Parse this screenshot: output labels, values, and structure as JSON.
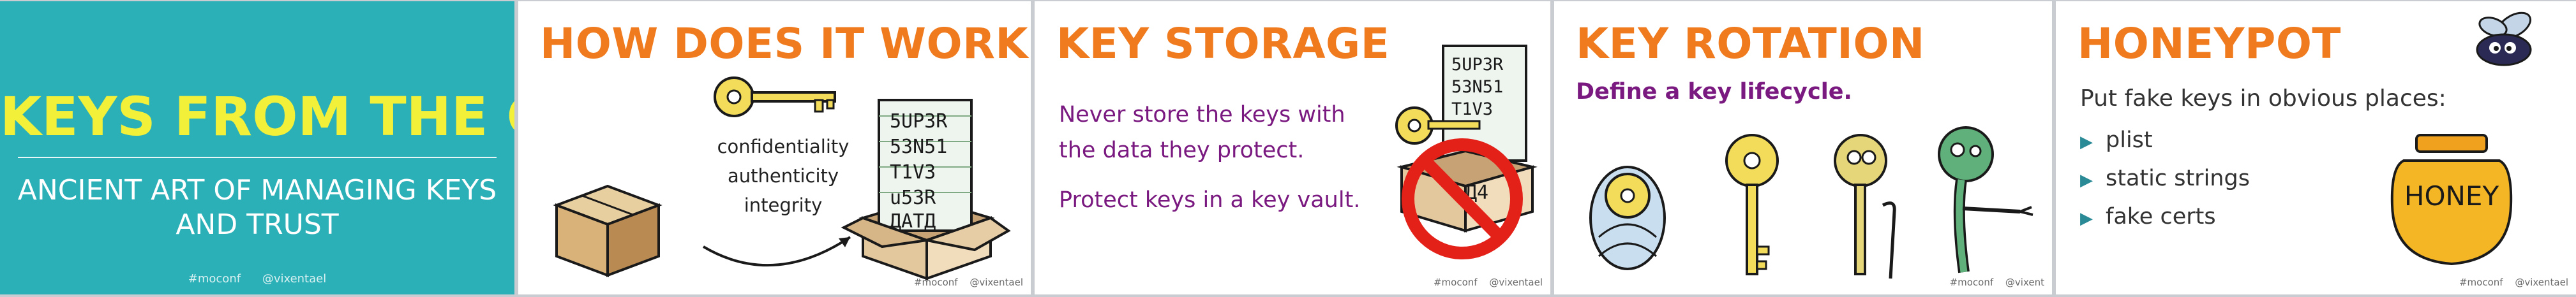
{
  "slides": [
    {
      "title": "KEYS FROM THE CASTLE",
      "subtitle_line1": "ANCIENT ART OF MANAGING KEYS",
      "subtitle_line2": "AND TRUST",
      "footer": [
        "#moconf",
        "@vixentael"
      ],
      "background": "#2bb0b8",
      "title_color": "#f3f03a"
    },
    {
      "title": "HOW DOES IT WORK?",
      "words": [
        "confidentiality",
        "authenticity",
        "integrity"
      ],
      "paper_text": [
        "5UP3R",
        "53N51",
        "T1V3",
        "u53R",
        "ДATД"
      ],
      "footer": [
        "#moconf",
        "@vixentael"
      ]
    },
    {
      "title": "KEY STORAGE",
      "paragraph1_line1": "Never store the keys with",
      "paragraph1_line2": "the data they protect.",
      "paragraph2": "Protect keys in a key vault.",
      "paper_text": [
        "5UP3R",
        "53N51",
        "T1V3"
      ],
      "box_text": "Д4",
      "footer": [
        "#moconf",
        "@vixentael"
      ]
    },
    {
      "title": "KEY ROTATION",
      "subtitle": "Define a key lifecycle.",
      "footer": [
        "#moconf",
        "@vixent"
      ]
    },
    {
      "title": "HONEYPOT",
      "intro": "Put fake keys in obvious places:",
      "items": [
        "plist",
        "static strings",
        "fake certs"
      ],
      "pot_label": "HONEY",
      "footer": [
        "#moconf",
        "@vixentael"
      ]
    }
  ],
  "colors": {
    "accent": "#f07a1e",
    "purple": "#7a1a80",
    "teal": "#2bb0b8"
  }
}
